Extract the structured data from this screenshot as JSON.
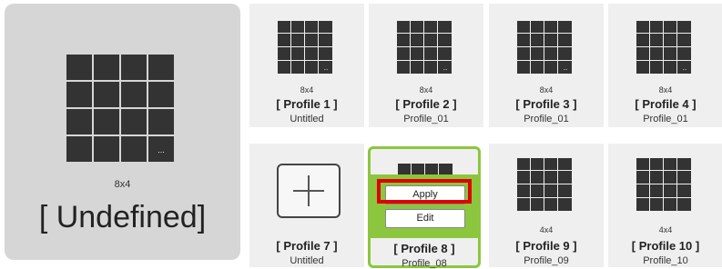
{
  "undefined_panel": {
    "dim": "8x4",
    "title": "[ Undefined]",
    "more_label": "..."
  },
  "profiles": [
    {
      "name": "[ Profile 1 ]",
      "dim": "8x4",
      "sub": "Untitled"
    },
    {
      "name": "[ Profile 2 ]",
      "dim": "8x4",
      "sub": "Profile_01"
    },
    {
      "name": "[ Profile 3 ]",
      "dim": "8x4",
      "sub": "Profile_01"
    },
    {
      "name": "[ Profile 4 ]",
      "dim": "8x4",
      "sub": "Profile_01"
    },
    {
      "name": "[ Profile 7 ]",
      "dim": "",
      "sub": "Untitled"
    },
    {
      "name": "[ Profile 8 ]",
      "dim": "",
      "sub": "Profile_08"
    },
    {
      "name": "[ Profile 9 ]",
      "dim": "4x4",
      "sub": "Profile_09"
    },
    {
      "name": "[ Profile 10 ]",
      "dim": "4x4",
      "sub": "Profile_10"
    }
  ],
  "context_menu": {
    "apply_label": "Apply",
    "edit_label": "Edit"
  },
  "colors": {
    "tile": "#333333",
    "selected_border": "#8cc63f",
    "highlight": "#e00000",
    "panel": "#d6d6d6",
    "card": "#efefef"
  }
}
